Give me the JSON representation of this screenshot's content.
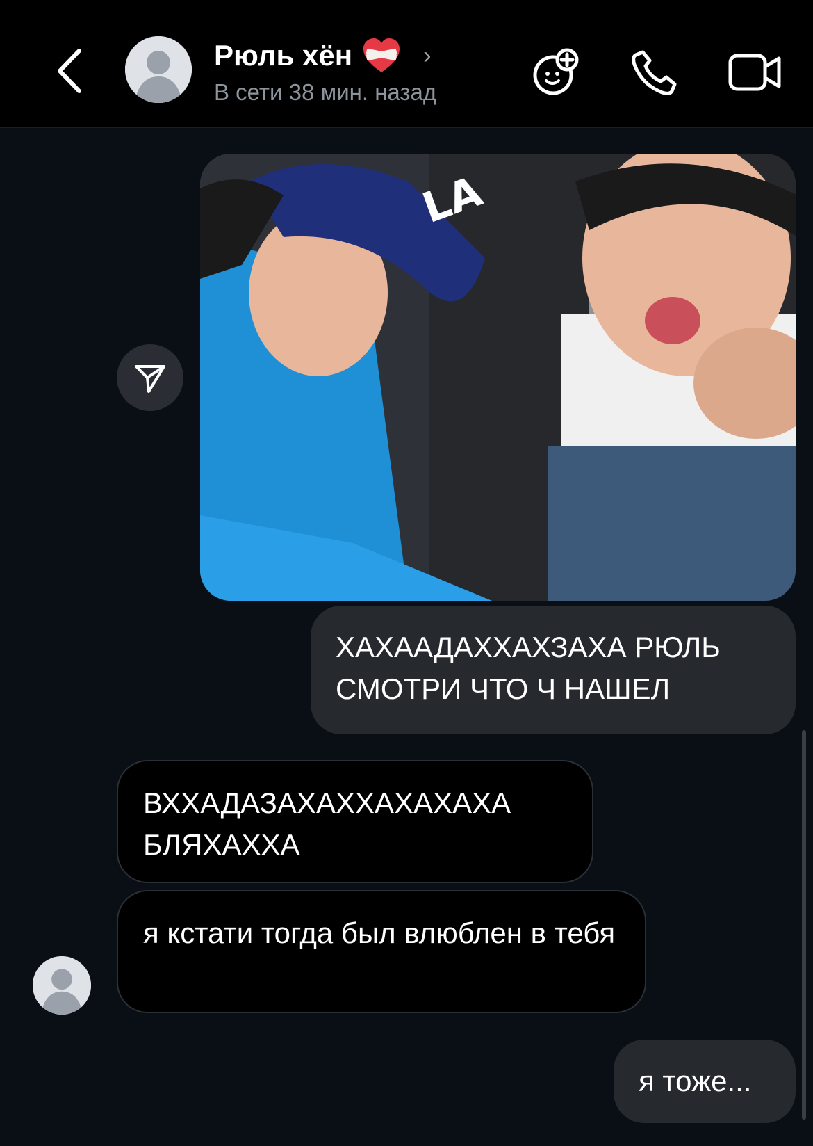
{
  "header": {
    "title": "Рюль хён",
    "status": "В сети 38 мин. назад",
    "icons": {
      "back": "chevron-left-icon",
      "heart": "mending-heart-icon",
      "chevron": "chevron-right-icon",
      "games": "game-controller-plus-icon",
      "call": "phone-icon",
      "video": "video-camera-icon"
    }
  },
  "messages": [
    {
      "side": "image",
      "kind": "photo"
    },
    {
      "side": "sent",
      "text": "ХАХААДАХХАХЗАХА РЮЛЬ СМОТРИ ЧТО Ч НАШЕЛ"
    },
    {
      "side": "received",
      "text": "ВХХАДАЗАХАХХАХАХАХА БЛЯХАХХА"
    },
    {
      "side": "received",
      "text": "я кстати тогда был влюблен в тебя"
    },
    {
      "side": "sent",
      "text": "я тоже..."
    }
  ],
  "colors": {
    "background": "#0a0f15",
    "header": "#000000",
    "sent_bubble": "#262a2f",
    "received_bubble": "#000000",
    "muted_text": "#8e949b"
  }
}
